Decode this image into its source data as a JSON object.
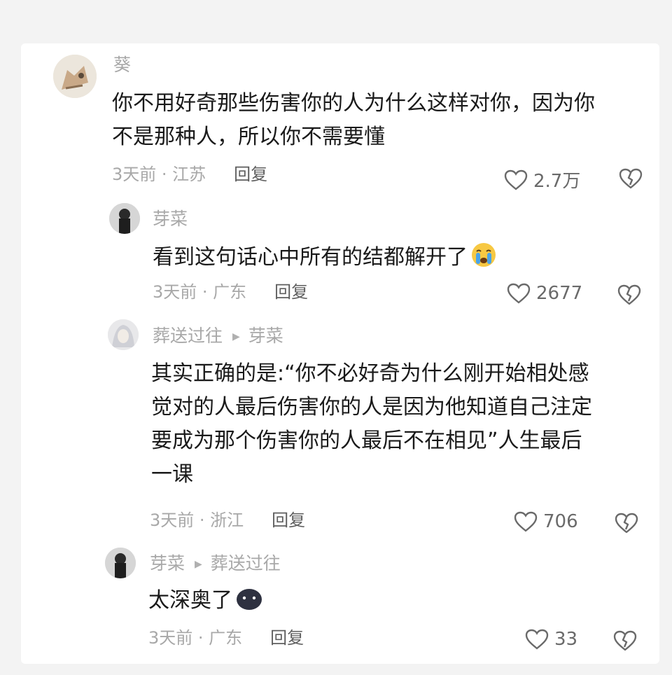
{
  "comments": [
    {
      "username": "葵",
      "lines": [
        "你不用好奇那些伤害你的人为什么这样对你，因为你",
        "不是那种人，所以你不需要懂"
      ],
      "time": "3天前 · 江苏",
      "reply": "回复",
      "likes": "2.7万"
    },
    {
      "username": "芽菜",
      "lines": [
        "看到这句话心中所有的结都解开了"
      ],
      "emoji": "crying-face",
      "time": "3天前 · 广东",
      "reply": "回复",
      "likes": "2677"
    },
    {
      "username": "葬送过往",
      "reply_to": "芽菜",
      "lines": [
        "其实正确的是:“你不必好奇为什么刚开始相处感",
        "觉对的人最后伤害你的人是因为他知道自己注定",
        "要成为那个伤害你的人最后不在相见”人生最后",
        "一课"
      ],
      "time": "3天前 · 浙江",
      "reply": "回复",
      "likes": "706"
    },
    {
      "username": "芽菜",
      "reply_to": "葬送过往",
      "lines": [
        "太深奥了"
      ],
      "emoji": "dark-blob-face",
      "time": "3天前 · 广东",
      "reply": "回复",
      "likes": "33"
    }
  ],
  "colors": {
    "meta": "#a8a8a8",
    "text": "#1a1a1a",
    "card": "#ffffff",
    "bg": "#f3f3f3"
  }
}
